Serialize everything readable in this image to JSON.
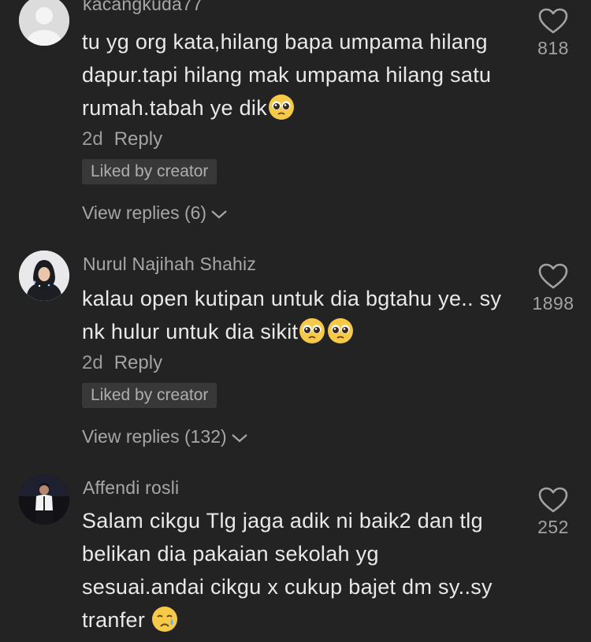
{
  "comments": [
    {
      "username": "kacangkuda77",
      "text": "tu yg org kata,hilang bapa umpama hilang dapur.tapi hilang mak umpama hilang satu rumah.tabah ye dik",
      "emoji_icons": [
        "pleading-face-icon"
      ],
      "time": "2d",
      "reply_label": "Reply",
      "badge": "Liked by creator",
      "view_replies": "View replies (6)",
      "likes": "818"
    },
    {
      "username": "Nurul Najihah Shahiz",
      "text": "kalau open kutipan untuk dia bgtahu ye.. sy nk hulur untuk dia sikit",
      "emoji_icons": [
        "pleading-face-icon",
        "pleading-face-icon"
      ],
      "time": "2d",
      "reply_label": "Reply",
      "badge": "Liked by creator",
      "view_replies": "View replies (132)",
      "likes": "1898"
    },
    {
      "username": "Affendi rosli",
      "text": "Salam cikgu Tlg jaga adik ni baik2 dan tlg belikan dia pakaian sekolah yg sesuai.andai cikgu x cukup bajet dm sy..sy tranfer",
      "emoji_icons": [
        "crying-face-icon"
      ],
      "likes": "252"
    }
  ],
  "colors": {
    "background": "#232323",
    "text": "#e9e9e9",
    "muted": "#a3a3a3",
    "badge_bg": "#383838"
  }
}
